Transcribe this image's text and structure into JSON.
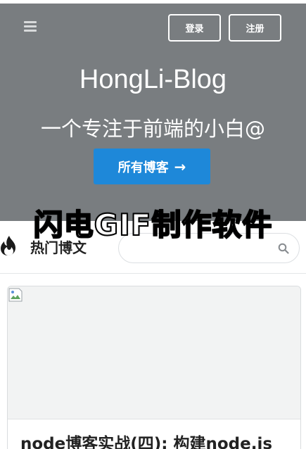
{
  "header": {
    "login_label": "登录",
    "register_label": "注册",
    "menu_icon": "hamburger-menu-icon"
  },
  "hero": {
    "title": "HongLi-Blog",
    "subtitle": "一个专注于前端的小白@",
    "all_blogs_label": "所有博客",
    "all_blogs_arrow": "→",
    "background_color": "#797d80",
    "button_color": "#1e88d9"
  },
  "watermark": {
    "text": "闪电GIF制作软件"
  },
  "hot": {
    "title": "热门博文",
    "icon": "fire-icon",
    "search_placeholder": "",
    "search_icon": "search-icon"
  },
  "posts": [
    {
      "title": "node博客实战(四): 构建node.js",
      "image_icon": "broken-image-icon"
    }
  ]
}
